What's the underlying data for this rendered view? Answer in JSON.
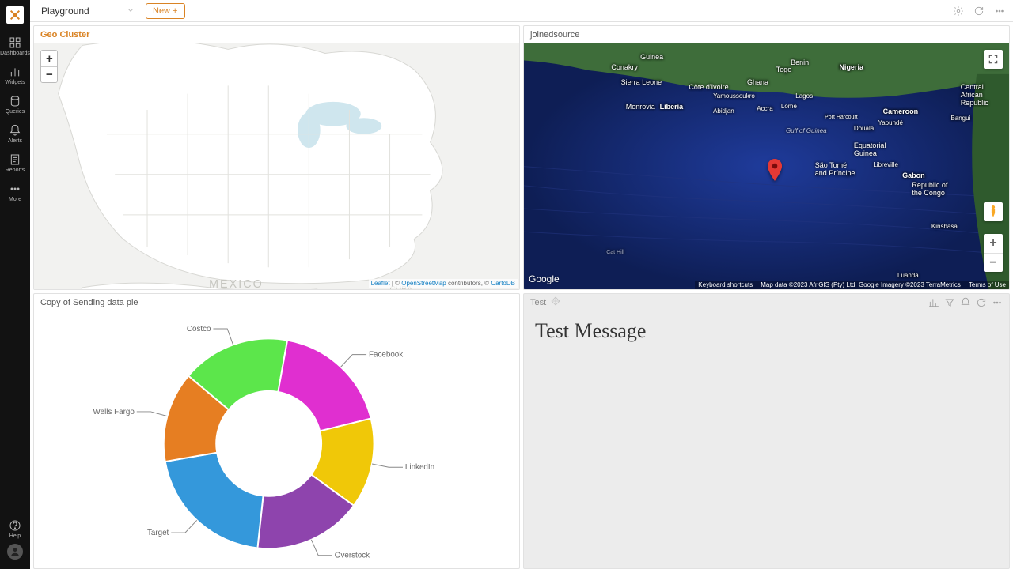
{
  "sidebar": {
    "items": [
      {
        "id": "dashboards",
        "label": "Dashboards"
      },
      {
        "id": "widgets",
        "label": "Widgets"
      },
      {
        "id": "queries",
        "label": "Queries"
      },
      {
        "id": "alerts",
        "label": "Alerts"
      },
      {
        "id": "reports",
        "label": "Reports"
      },
      {
        "id": "more",
        "label": "More"
      }
    ],
    "help_label": "Help"
  },
  "topbar": {
    "page_name": "Playground",
    "new_label": "New +"
  },
  "panels": {
    "geo": {
      "title": "Geo Cluster",
      "labels": {
        "mexico": "MEXICO",
        "cuba": "CUBA"
      },
      "attrib": {
        "leaflet": "Leaflet",
        "sep": " | © ",
        "osm": "OpenStreetMap",
        "tail": " contributors, © ",
        "carto": "CartoDB"
      }
    },
    "gmap": {
      "title": "joinedsource",
      "google": "Google",
      "labels": {
        "guinea": "Guinea",
        "conakry": "Conakry",
        "sierra": "Sierra Leone",
        "monrovia": "Monrovia",
        "liberia": "Liberia",
        "cote": "Côte d'Ivoire",
        "yamoussoukro": "Yamoussoukro",
        "abidjan": "Abidjan",
        "ghana": "Ghana",
        "accra": "Accra",
        "togo": "Togo",
        "lome": "Lomé",
        "benin": "Benin",
        "nigeria": "Nigeria",
        "lagos": "Lagos",
        "portharcourt": "Port Harcourt",
        "cameroon": "Cameroon",
        "yaounde": "Yaoundé",
        "douala": "Douala",
        "bangui": "Bangui",
        "car": "Central\nAfrican\nRepublic",
        "eqg": "Equatorial\nGuinea",
        "libreville": "Libreville",
        "saotome": "São Tomé\nand Príncipe",
        "gabon": "Gabon",
        "congo": "Republic of\nthe Congo",
        "kinshasa": "Kinshasa",
        "luanda": "Luanda",
        "gulf": "Gulf of Guinea",
        "cathill": "Cat Hill"
      },
      "footer": {
        "shortcuts": "Keyboard shortcuts",
        "mapdata": "Map data ©2023 AfriGIS (Pty) Ltd, Google  Imagery ©2023 TerraMetrics",
        "terms": "Terms of Use"
      }
    },
    "pie": {
      "title": "Copy of Sending data pie"
    },
    "text": {
      "header_label": "Test",
      "message": "Test Message"
    }
  },
  "chart_data": {
    "type": "pie",
    "title": "Copy of Sending data pie",
    "series": [
      {
        "name": "Costco",
        "value": 60,
        "color": "#5ce64b"
      },
      {
        "name": "Facebook",
        "value": 66,
        "color": "#e02fd0"
      },
      {
        "name": "LinkedIn",
        "value": 50,
        "color": "#f0c808"
      },
      {
        "name": "Overstock",
        "value": 60,
        "color": "#8e44ad"
      },
      {
        "name": "Target",
        "value": 74,
        "color": "#3498db"
      },
      {
        "name": "Wells Fargo",
        "value": 50,
        "color": "#e67e22"
      }
    ],
    "inner_radius_pct": 50
  }
}
